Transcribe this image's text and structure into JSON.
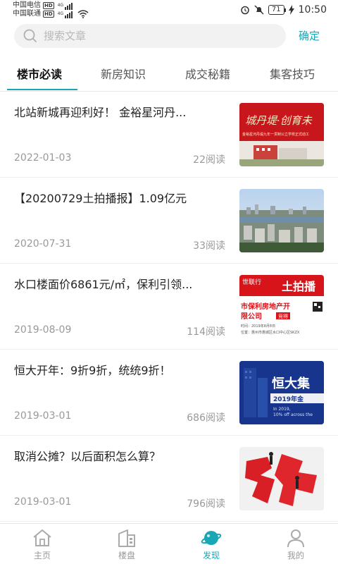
{
  "status_bar": {
    "carrier1": "中国电信",
    "carrier2": "中国联通",
    "hd": "HD",
    "net1": "4G",
    "net2": "4G",
    "battery": "71",
    "time": "10:50"
  },
  "search": {
    "placeholder": "搜索文章",
    "confirm_label": "确定"
  },
  "tabs": [
    {
      "label": "楼市必读",
      "active": true
    },
    {
      "label": "新房知识",
      "active": false
    },
    {
      "label": "成交秘籍",
      "active": false
    },
    {
      "label": "集客技巧",
      "active": false
    }
  ],
  "articles": [
    {
      "title": "北站新城再迎利好！ 金裕星河丹...",
      "date": "2022-01-03",
      "reads": "22阅读",
      "thumb": {
        "text1": "城丹堤·创育未",
        "text2": "金裕星河丹堤九年一贯制公立学校正式动工"
      }
    },
    {
      "title": "【20200729土拍播报】1.09亿元",
      "date": "2020-07-31",
      "reads": "33阅读",
      "thumb": {}
    },
    {
      "title": "水口楼面价6861元/㎡，保利引领...",
      "date": "2019-08-09",
      "reads": "114阅读",
      "thumb": {
        "text1": "世联行",
        "text2": "土拍播",
        "text3": "市保利房地产开",
        "text4": "限公司",
        "text5": "竞得",
        "text6": "时间：2019年8月8日",
        "text7": "位置：惠州市惠城区水口中心区SKZX"
      }
    },
    {
      "title": "恒大开年：9折9折，统统9折！",
      "date": "2019-03-01",
      "reads": "686阅读",
      "thumb": {
        "text1": "恒大集",
        "text2": "2019年金",
        "text3": "In 2019,",
        "text4": "10% off across the"
      }
    },
    {
      "title": "取消公摊？以后面积怎么算？",
      "date": "2019-03-01",
      "reads": "796阅读",
      "thumb": {}
    }
  ],
  "bottom_nav": [
    {
      "label": "主页",
      "icon": "home-icon",
      "active": false
    },
    {
      "label": "楼盘",
      "icon": "building-icon",
      "active": false
    },
    {
      "label": "发现",
      "icon": "planet-icon",
      "active": true
    },
    {
      "label": "我的",
      "icon": "user-icon",
      "active": false
    }
  ],
  "colors": {
    "accent": "#19a7b5",
    "muted": "#999999"
  }
}
